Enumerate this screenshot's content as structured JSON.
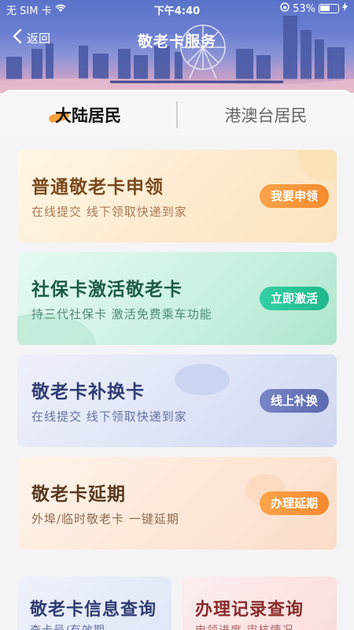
{
  "status_bar": {
    "carrier": "无 SIM 卡",
    "time": "下午4:40",
    "battery": "53%"
  },
  "nav": {
    "back_label": "返回",
    "title": "敬老卡服务"
  },
  "tabs": [
    {
      "label": "大陆居民",
      "active": true
    },
    {
      "label": "港澳台居民",
      "active": false
    }
  ],
  "cards": [
    {
      "title": "普通敬老卡申领",
      "subtitle": "在线提交  线下领取快递到家",
      "button": "我要申领"
    },
    {
      "title": "社保卡激活敬老卡",
      "subtitle": "持三代社保卡  激活免费乘车功能",
      "button": "立即激活"
    },
    {
      "title": "敬老卡补换卡",
      "subtitle": "在线提交  线下领取快递到家",
      "button": "线上补换"
    },
    {
      "title": "敬老卡延期",
      "subtitle": "外埠/临时敬老卡  一键延期",
      "button": "办理延期"
    }
  ],
  "bottom_cards": [
    {
      "title": "敬老卡信息查询",
      "subtitle": "查卡号/有效期"
    },
    {
      "title": "办理记录查询",
      "subtitle": "申领进度  审核情况"
    }
  ],
  "colors": {
    "orange_button": "#f58a2e",
    "green_button": "#1fb88c",
    "blue_button": "#5a69ae"
  }
}
